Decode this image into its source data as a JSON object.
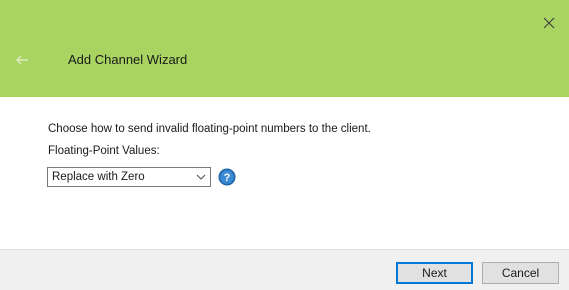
{
  "window": {
    "title": "Add Channel Wizard",
    "header_color": "#a9d461"
  },
  "icons": {
    "close": "close-icon",
    "back": "back-arrow-icon",
    "dropdown": "chevron-down-icon",
    "help": "help-icon"
  },
  "content": {
    "instruction": "Choose how to send invalid floating-point numbers to the client.",
    "field_label": "Floating-Point Values:",
    "selected_value": "Replace with Zero"
  },
  "footer": {
    "next_label": "Next",
    "cancel_label": "Cancel"
  },
  "colors": {
    "accent": "#0078d7",
    "help_icon": "#2b79c2"
  }
}
